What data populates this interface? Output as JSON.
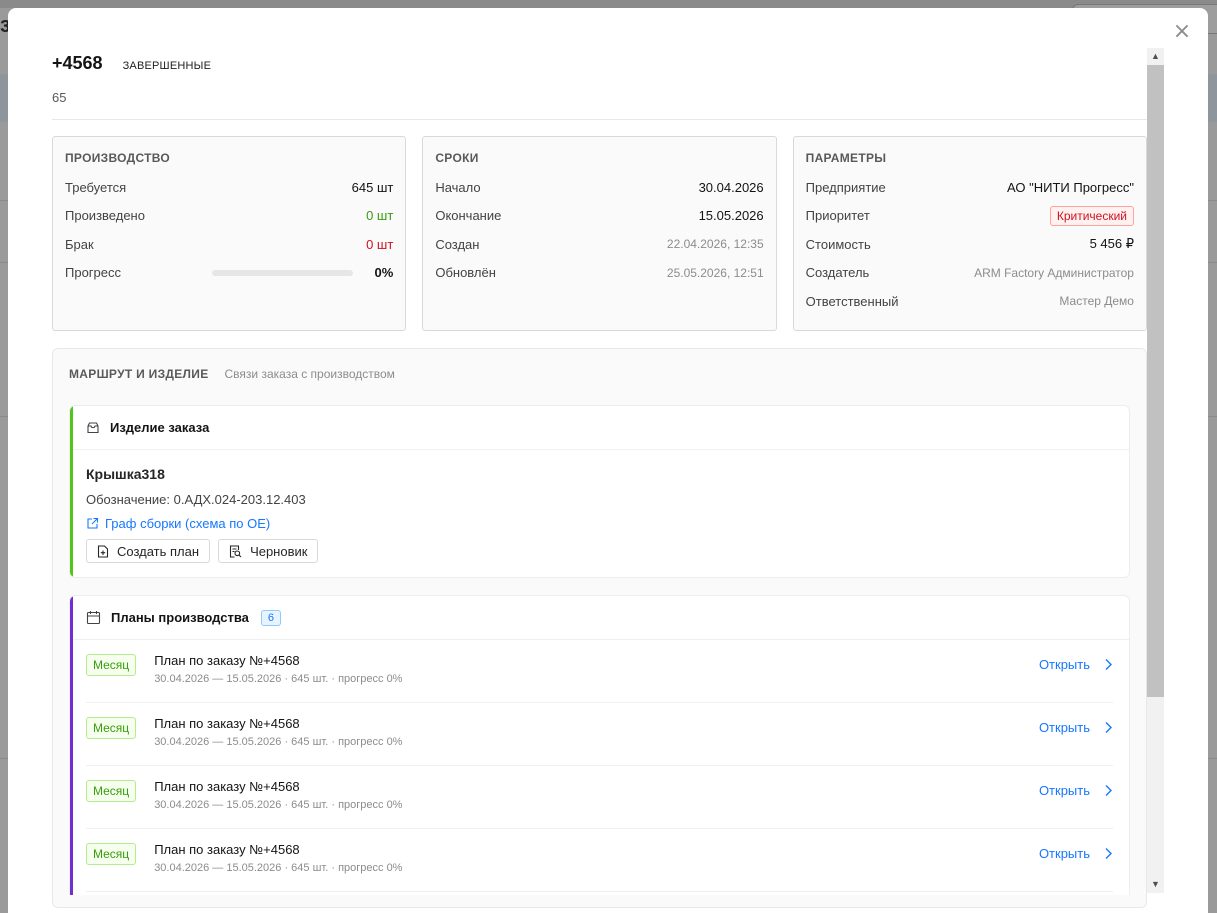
{
  "background": {
    "left_fragment": "з",
    "right_fragment": ""
  },
  "modal": {
    "close_icon": "×",
    "order_number": "+4568",
    "status": "ЗАВЕРШЕННЫЕ",
    "subtitle": "65"
  },
  "production": {
    "title": "ПРОИЗВОДСТВО",
    "required_label": "Требуется",
    "required_value": "645 шт",
    "produced_label": "Произведено",
    "produced_value": "0 шт",
    "defect_label": "Брак",
    "defect_value": "0 шт",
    "progress_label": "Прогресс",
    "progress_value": "0%",
    "progress_fraction": 0
  },
  "deadlines": {
    "title": "СРОКИ",
    "start_label": "Начало",
    "start_value": "30.04.2026",
    "end_label": "Окончание",
    "end_value": "15.05.2026",
    "created_label": "Создан",
    "created_value": "22.04.2026, 12:35",
    "updated_label": "Обновлён",
    "updated_value": "25.05.2026, 12:51"
  },
  "parameters": {
    "title": "ПАРАМЕТРЫ",
    "enterprise_label": "Предприятие",
    "enterprise_value": "АО \"НИТИ Прогресс\"",
    "priority_label": "Приоритет",
    "priority_value": "Критический",
    "cost_label": "Стоимость",
    "cost_value": "5 456 ₽",
    "creator_label": "Создатель",
    "creator_value": "ARM Factory Администратор",
    "responsible_label": "Ответственный",
    "responsible_value": "Мастер Демо"
  },
  "route": {
    "title": "МАРШРУТ И ИЗДЕЛИЕ",
    "subtitle": "Связи заказа с производством",
    "product_box": {
      "title": "Изделие заказа",
      "product_name": "Крышка318",
      "designation": "Обозначение: 0.АДХ.024-203.12.403",
      "graph_link": "Граф сборки (схема по ОЕ)",
      "create_plan_label": "Создать план",
      "draft_label": "Черновик"
    },
    "plans_box": {
      "title": "Планы производства",
      "count": "6",
      "items": [
        {
          "period": "Месяц",
          "name": "План по заказу №+4568",
          "meta": "30.04.2026 — 15.05.2026 · 645 шт. · прогресс 0%",
          "open": "Открыть"
        },
        {
          "period": "Месяц",
          "name": "План по заказу №+4568",
          "meta": "30.04.2026 — 15.05.2026 · 645 шт. · прогресс 0%",
          "open": "Открыть"
        },
        {
          "period": "Месяц",
          "name": "План по заказу №+4568",
          "meta": "30.04.2026 — 15.05.2026 · 645 шт. · прогресс 0%",
          "open": "Открыть"
        },
        {
          "period": "Месяц",
          "name": "План по заказу №+4568",
          "meta": "30.04.2026 — 15.05.2026 · 645 шт. · прогресс 0%",
          "open": "Открыть"
        }
      ]
    }
  },
  "colors": {
    "accent": "#1677ff",
    "success": "#389e0d",
    "danger": "#cf1322",
    "product_bar": "#52c41a",
    "plans_bar": "#722ed1"
  },
  "icons": {
    "close": "close-icon",
    "product": "inbox-icon",
    "link": "external-link-icon",
    "create_plan": "file-add-icon",
    "draft": "file-search-icon",
    "plans": "calendar-icon",
    "open": "chevron-right-icon"
  }
}
